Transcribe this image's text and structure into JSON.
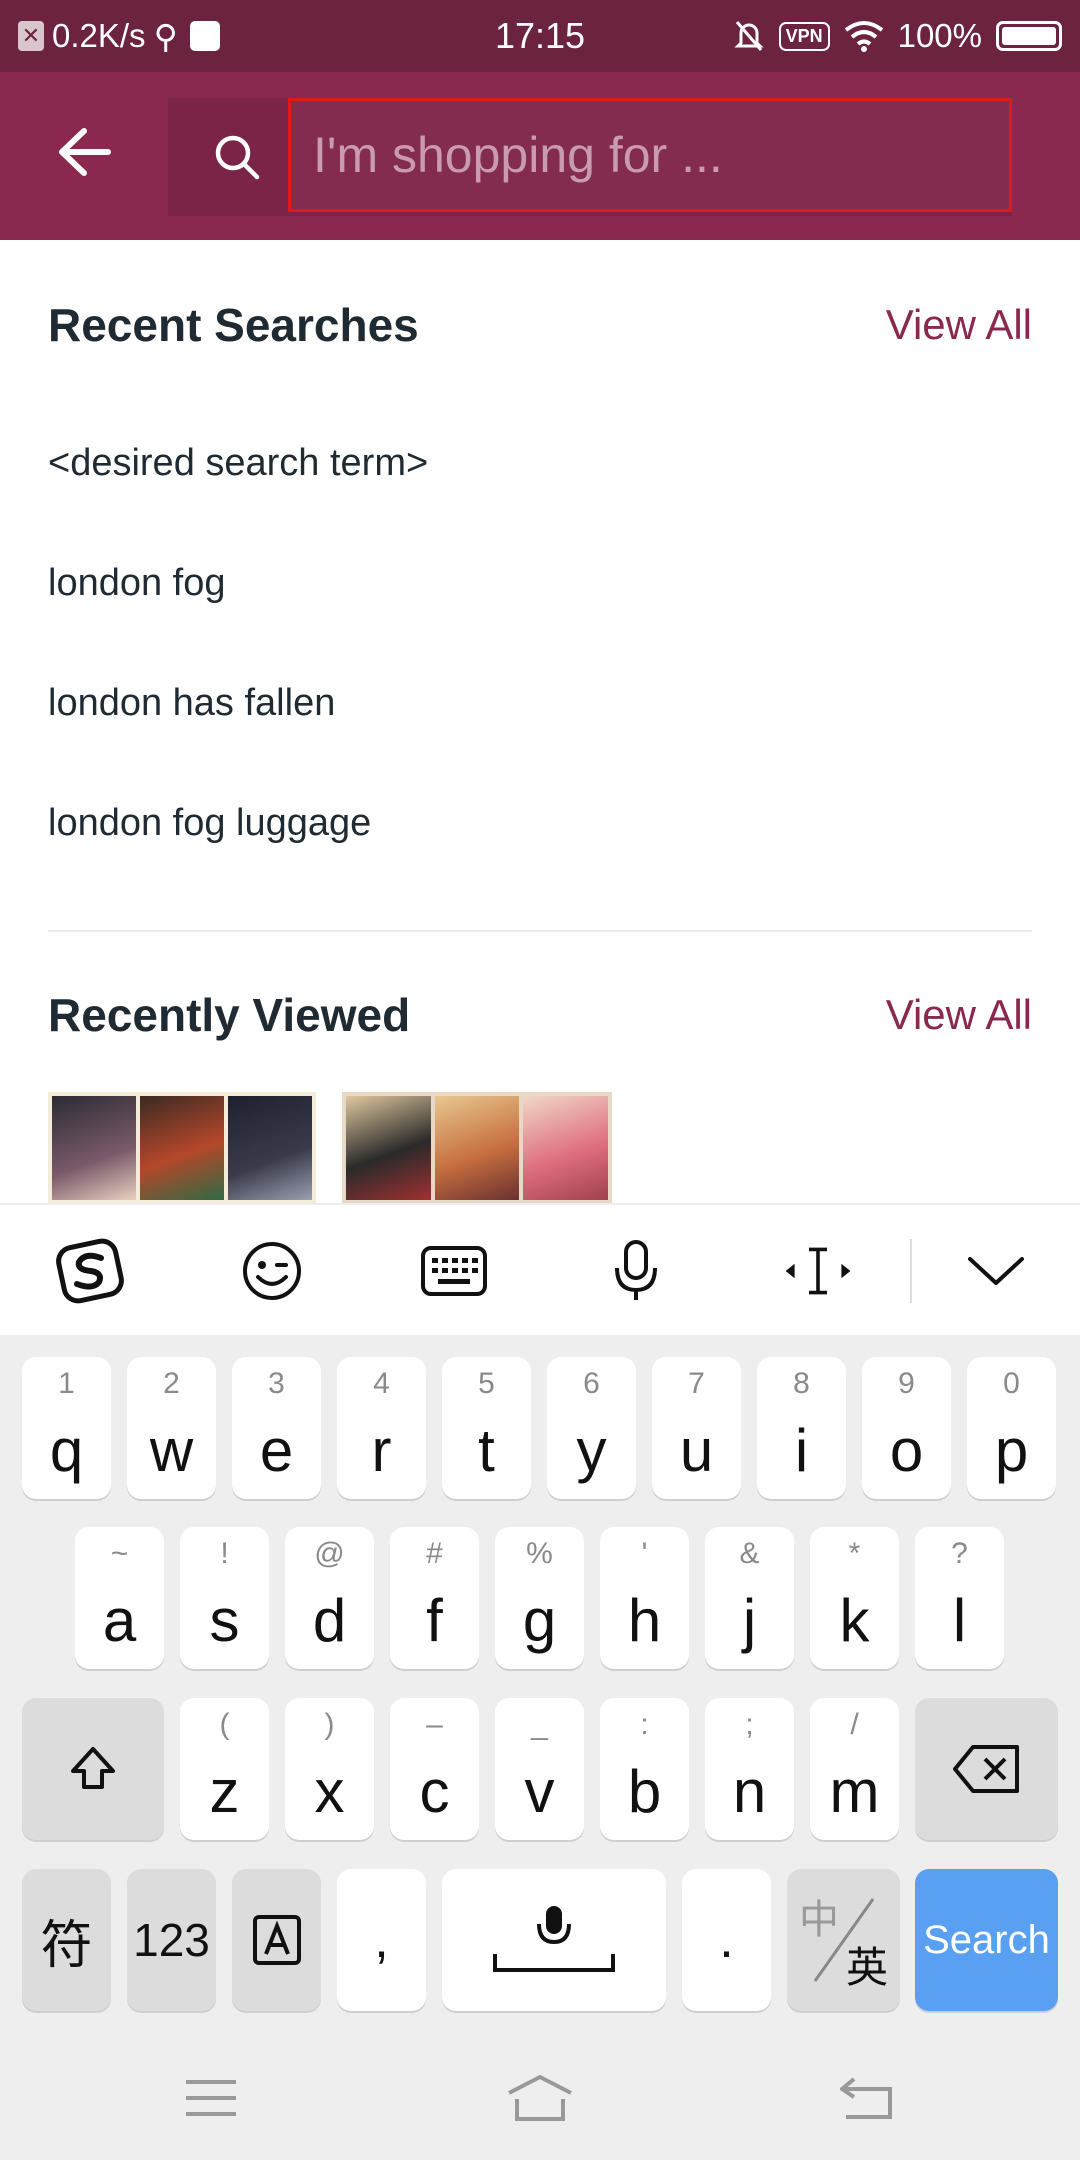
{
  "status_bar": {
    "speed": "0.2K/s",
    "time": "17:15",
    "vpn": "VPN",
    "battery": "100%"
  },
  "header": {
    "search_placeholder": "I'm shopping for ..."
  },
  "recent_searches": {
    "title": "Recent Searches",
    "view_all": "View All",
    "items": [
      "<desired search term>",
      "london fog",
      "london has fallen",
      "london fog luggage"
    ]
  },
  "recently_viewed": {
    "title": "Recently Viewed",
    "view_all": "View All",
    "items": [
      "poster-thumbnail-1",
      "poster-thumbnail-2"
    ]
  },
  "keyboard": {
    "row1": [
      {
        "hint": "1",
        "key": "q"
      },
      {
        "hint": "2",
        "key": "w"
      },
      {
        "hint": "3",
        "key": "e"
      },
      {
        "hint": "4",
        "key": "r"
      },
      {
        "hint": "5",
        "key": "t"
      },
      {
        "hint": "6",
        "key": "y"
      },
      {
        "hint": "7",
        "key": "u"
      },
      {
        "hint": "8",
        "key": "i"
      },
      {
        "hint": "9",
        "key": "o"
      },
      {
        "hint": "0",
        "key": "p"
      }
    ],
    "row2": [
      {
        "hint": "~",
        "key": "a"
      },
      {
        "hint": "!",
        "key": "s"
      },
      {
        "hint": "@",
        "key": "d"
      },
      {
        "hint": "#",
        "key": "f"
      },
      {
        "hint": "%",
        "key": "g"
      },
      {
        "hint": "'",
        "key": "h"
      },
      {
        "hint": "&",
        "key": "j"
      },
      {
        "hint": "*",
        "key": "k"
      },
      {
        "hint": "?",
        "key": "l"
      }
    ],
    "row3": [
      {
        "hint": "(",
        "key": "z"
      },
      {
        "hint": ")",
        "key": "x"
      },
      {
        "hint": "–",
        "key": "c"
      },
      {
        "hint": "_",
        "key": "v"
      },
      {
        "hint": ":",
        "key": "b"
      },
      {
        "hint": ";",
        "key": "n"
      },
      {
        "hint": "/",
        "key": "m"
      }
    ],
    "symbols_key": "符",
    "numbers_key": "123",
    "comma_key": ",",
    "period_key": ".",
    "lang_key_top": "中",
    "lang_key_bottom": "英",
    "search_key": "Search"
  }
}
